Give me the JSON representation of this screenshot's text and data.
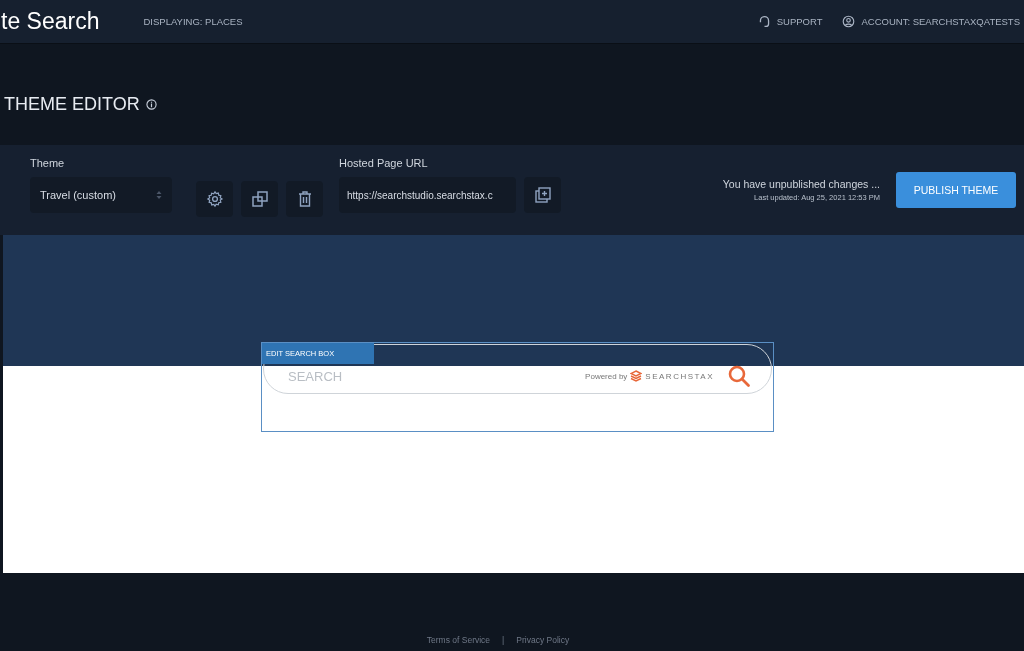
{
  "header": {
    "app_title": "te Search",
    "displaying": "DISPLAYING: PLACES",
    "support": "SUPPORT",
    "account": "ACCOUNT: SEARCHSTAXQATESTS"
  },
  "page": {
    "title": "THEME EDITOR"
  },
  "toolbar": {
    "theme_label": "Theme",
    "theme_value": "Travel (custom)",
    "url_label": "Hosted Page URL",
    "url_value": "https://searchstudio.searchstax.c",
    "status": "You have unpublished changes ...",
    "last_updated": "Last updated: Aug 25, 2021 12:53 PM",
    "publish_button": "PUBLISH THEME"
  },
  "preview": {
    "edit_label": "EDIT SEARCH BOX",
    "search_placeholder": "SEARCH",
    "powered_by": "Powered by",
    "brand": "SEARCHSTAX"
  },
  "footer": {
    "links": [
      "Terms of Service",
      "Privacy Policy"
    ],
    "separator": "|"
  }
}
